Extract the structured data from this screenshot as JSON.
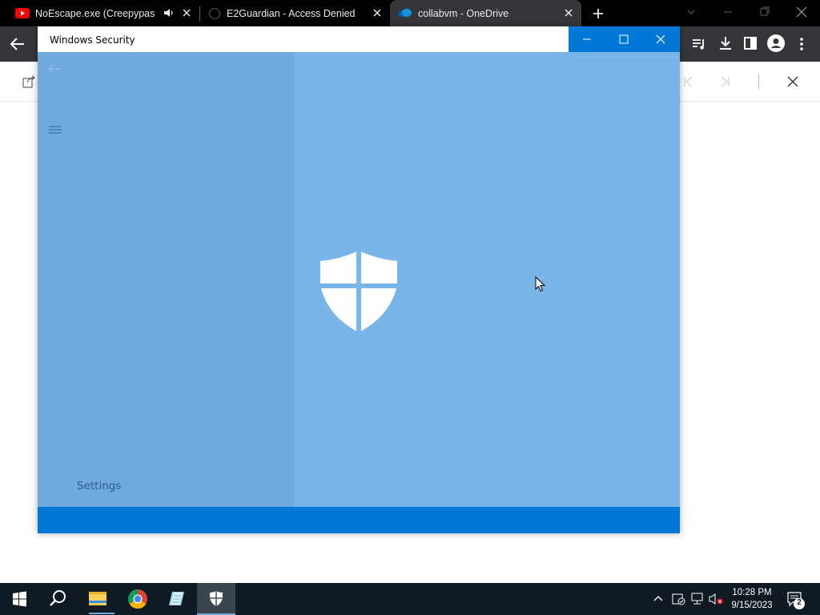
{
  "browser": {
    "tabs": [
      {
        "title": "NoEscape.exe (Creepypasta)",
        "icon": "youtube-icon",
        "active": false,
        "audible": true
      },
      {
        "title": "E2Guardian - Access Denied",
        "icon": "globe-icon",
        "active": false
      },
      {
        "title": "collabvm - OneDrive",
        "icon": "onedrive-icon",
        "active": true
      }
    ],
    "new_tab_icon": "plus-icon"
  },
  "window": {
    "title": "Windows Security",
    "sidebar": {
      "settings_label": "Settings"
    },
    "main_icon": "windows-defender-shield-icon"
  },
  "taskbar": {
    "apps": [
      "start-icon",
      "search-icon",
      "file-explorer-icon",
      "chrome-icon",
      "notepad-icon",
      "windows-security-icon"
    ],
    "clock": {
      "time": "10:28 PM",
      "date": "9/15/2023"
    },
    "notification_count": "2"
  },
  "colors": {
    "accent": "#0078d7",
    "sidebar": "#6fa9de",
    "main": "#7ab5e8",
    "taskbar": "#101a23",
    "chrome_dark": "#35363a"
  }
}
